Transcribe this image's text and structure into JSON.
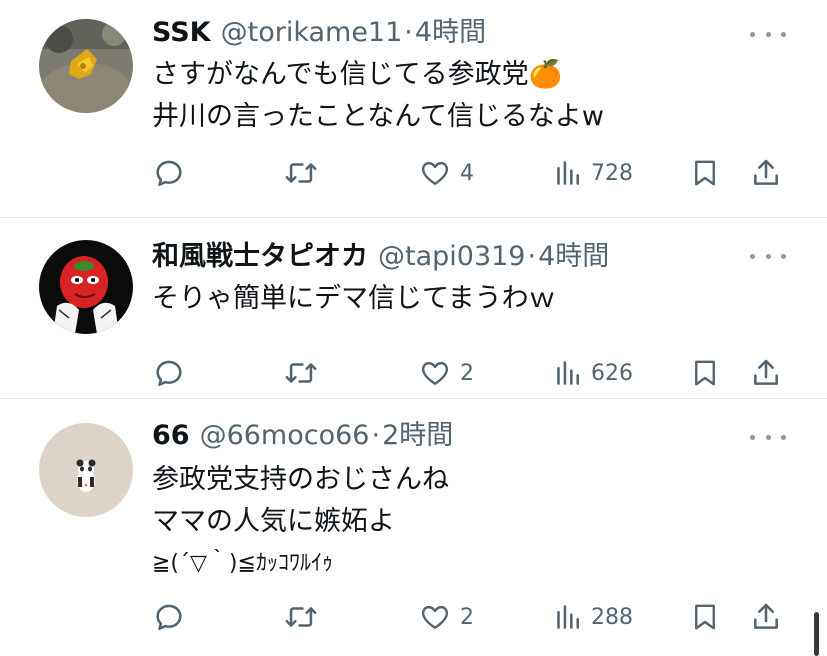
{
  "tweets": [
    {
      "name": "SSK",
      "handle": "@torikame11",
      "separator": "·",
      "time": "4時間",
      "lines": [
        "さすがなんでも信じてる参政党🍊",
        "井川の言ったことなんて信じるなよw"
      ],
      "reply_count": "",
      "retweet_count": "",
      "like_count": "4",
      "view_count": "728"
    },
    {
      "name": "和風戦士タピオカ",
      "handle": "@tapi0319",
      "separator": "·",
      "time": "4時間",
      "lines": [
        "そりゃ簡単にデマ信じてまうわｗ"
      ],
      "reply_count": "",
      "retweet_count": "",
      "like_count": "2",
      "view_count": "626"
    },
    {
      "name": "66",
      "handle": "@66moco66",
      "separator": "·",
      "time": "2時間",
      "lines": [
        "参政党支持のおじさんね",
        "ママの人気に嫉妬よ",
        "≧(´▽｀)≦ｶｯｺﾜﾙｲｩ"
      ],
      "reply_count": "",
      "retweet_count": "",
      "like_count": "2",
      "view_count": "288"
    }
  ],
  "icons": {
    "reply": "reply-icon",
    "retweet": "retweet-icon",
    "like": "heart-icon",
    "views": "views-chart-icon",
    "bookmark": "bookmark-icon",
    "share": "share-icon",
    "more": "more-icon"
  },
  "colors": {
    "text": "#0f1419",
    "secondary": "#536471",
    "divider": "#e3e6e9",
    "background": "#ffffff"
  }
}
